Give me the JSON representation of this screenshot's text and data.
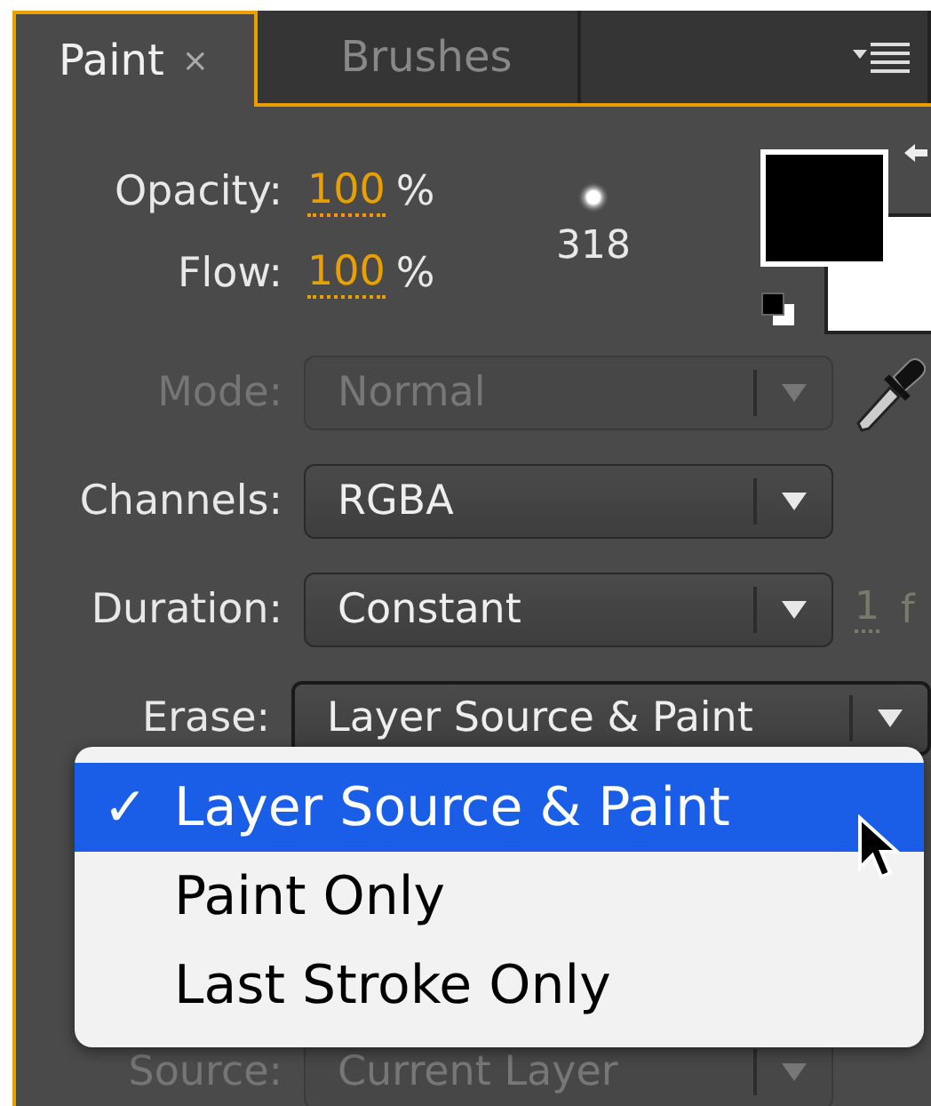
{
  "tabs": [
    {
      "label": "Paint",
      "selected": true,
      "closable": true,
      "close": "×"
    },
    {
      "label": "Brushes",
      "selected": false
    }
  ],
  "levels": [
    {
      "label": "Opacity:",
      "value": "100",
      "unit": "%"
    },
    {
      "label": "Flow:",
      "value": "100",
      "unit": "%"
    }
  ],
  "brush": {
    "size": "318"
  },
  "fields": [
    {
      "label": "Mode:",
      "value": "Normal",
      "disabled": true
    },
    {
      "label": "Channels:",
      "value": "RGBA",
      "disabled": false
    },
    {
      "label": "Duration:",
      "value": "Constant",
      "disabled": false,
      "extra": "1",
      "extra_unit": "f"
    },
    {
      "label": "Erase:",
      "value": "Layer Source & Paint",
      "disabled": false,
      "open": true
    },
    {
      "label": "Source:",
      "value": "Current Layer",
      "disabled": true
    }
  ],
  "menu": [
    {
      "label": "Layer Source & Paint",
      "selected": true,
      "check": "✓"
    },
    {
      "label": "Paint Only",
      "selected": false
    },
    {
      "label": "Last Stroke Only",
      "selected": false
    }
  ]
}
